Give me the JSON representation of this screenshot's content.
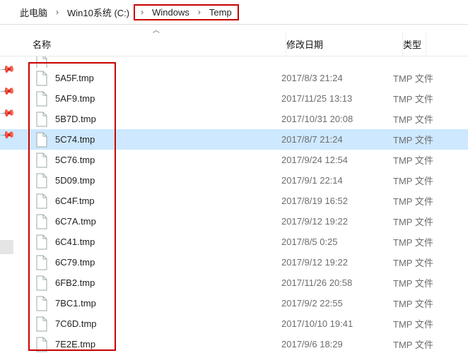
{
  "breadcrumb": {
    "parts": [
      "此电脑",
      "Win10系统 (C:)",
      "Windows",
      "Temp"
    ]
  },
  "columns": {
    "name": "名称",
    "date": "修改日期",
    "type": "类型"
  },
  "partial_top": {
    "name": "",
    "date": "",
    "type": ""
  },
  "files": [
    {
      "name": "5A5F.tmp",
      "date": "2017/8/3 21:24",
      "type": "TMP 文件",
      "selected": false
    },
    {
      "name": "5AF9.tmp",
      "date": "2017/11/25 13:13",
      "type": "TMP 文件",
      "selected": false
    },
    {
      "name": "5B7D.tmp",
      "date": "2017/10/31 20:08",
      "type": "TMP 文件",
      "selected": false
    },
    {
      "name": "5C74.tmp",
      "date": "2017/8/7 21:24",
      "type": "TMP 文件",
      "selected": true
    },
    {
      "name": "5C76.tmp",
      "date": "2017/9/24 12:54",
      "type": "TMP 文件",
      "selected": false
    },
    {
      "name": "5D09.tmp",
      "date": "2017/9/1 22:14",
      "type": "TMP 文件",
      "selected": false
    },
    {
      "name": "6C4F.tmp",
      "date": "2017/8/19 16:52",
      "type": "TMP 文件",
      "selected": false
    },
    {
      "name": "6C7A.tmp",
      "date": "2017/9/12 19:22",
      "type": "TMP 文件",
      "selected": false
    },
    {
      "name": "6C41.tmp",
      "date": "2017/8/5 0:25",
      "type": "TMP 文件",
      "selected": false
    },
    {
      "name": "6C79.tmp",
      "date": "2017/9/12 19:22",
      "type": "TMP 文件",
      "selected": false
    },
    {
      "name": "6FB2.tmp",
      "date": "2017/11/26 20:58",
      "type": "TMP 文件",
      "selected": false
    },
    {
      "name": "7BC1.tmp",
      "date": "2017/9/2 22:55",
      "type": "TMP 文件",
      "selected": false
    },
    {
      "name": "7C6D.tmp",
      "date": "2017/10/10 19:41",
      "type": "TMP 文件",
      "selected": false
    },
    {
      "name": "7E2E.tmp",
      "date": "2017/9/6 18:29",
      "type": "TMP 文件",
      "selected": false
    }
  ]
}
